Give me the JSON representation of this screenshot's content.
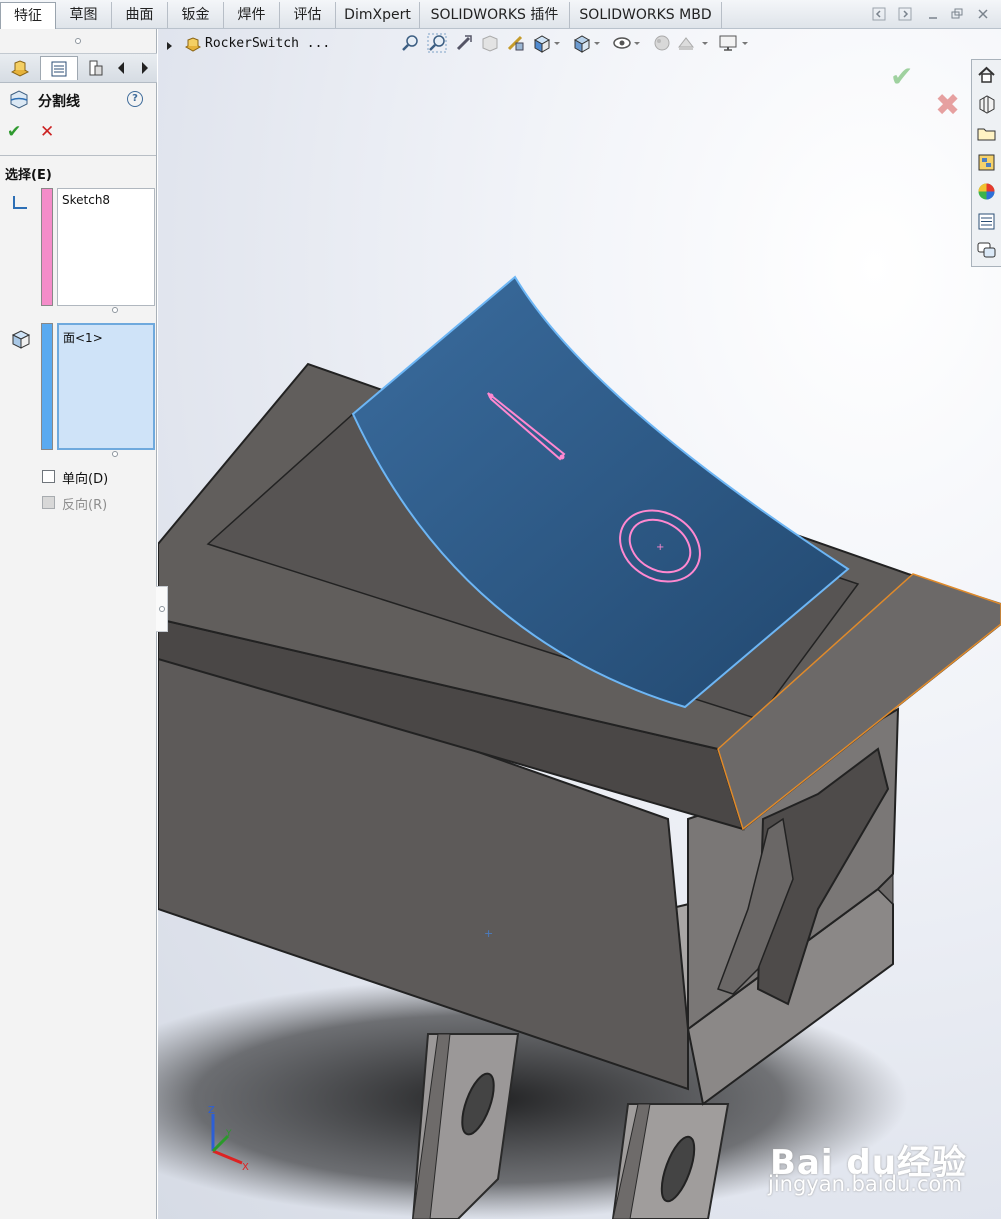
{
  "tabs": [
    {
      "label": "特征",
      "active": true
    },
    {
      "label": "草图"
    },
    {
      "label": "曲面"
    },
    {
      "label": "钣金"
    },
    {
      "label": "焊件"
    },
    {
      "label": "评估"
    },
    {
      "label": "DimXpert"
    },
    {
      "label": "SOLIDWORKS 插件"
    },
    {
      "label": "SOLIDWORKS MBD"
    }
  ],
  "property_manager": {
    "title": "分割线",
    "group_title": "选择(E)",
    "curve_selection": {
      "items": [
        "Sketch8"
      ],
      "color": "#f48cc9"
    },
    "face_selection": {
      "items": [
        "面<1>"
      ],
      "color": "#5aaaf0"
    },
    "options": [
      {
        "label": "单向(D)",
        "checked": false,
        "enabled": true
      },
      {
        "label": "反向(R)",
        "checked": false,
        "enabled": false
      }
    ]
  },
  "viewport": {
    "breadcrumb": "RockerSwitch  ..."
  },
  "watermark": {
    "brand": "Bai du经验",
    "url": "jingyan.baidu.com"
  },
  "colors": {
    "split_face": "#2f5f8f",
    "sketch_lines": "#ff88d0",
    "body": "#5f5c5a",
    "highlight_edge": "#e08a2a"
  }
}
